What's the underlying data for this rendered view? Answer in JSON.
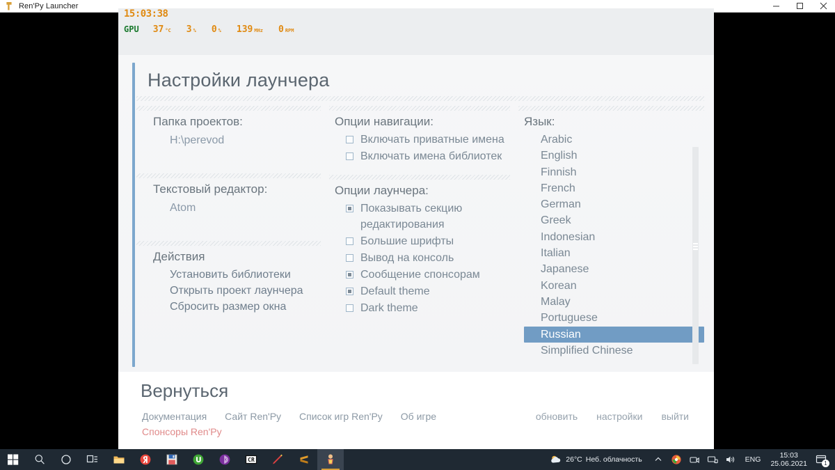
{
  "window": {
    "title": "Ren'Py Launcher",
    "app_icon": "renpy-icon",
    "minimize_label": "—",
    "maximize_label": "⬜",
    "close_label": "✕"
  },
  "hud": {
    "clock": "15:03:38",
    "gpu_label": "GPU",
    "stats": [
      {
        "value": "37",
        "unit": "°C"
      },
      {
        "value": "3",
        "unit": "%"
      },
      {
        "value": "0",
        "unit": "%"
      },
      {
        "value": "139",
        "unit": "MHz"
      },
      {
        "value": "0",
        "unit": "RPM"
      }
    ]
  },
  "page": {
    "title": "Настройки лаунчера"
  },
  "col1": {
    "projects": {
      "label": "Папка проектов:",
      "value": "H:\\perevod"
    },
    "editor": {
      "label": "Текстовый редактор:",
      "value": "Atom"
    },
    "actions": {
      "label": "Действия",
      "items": [
        "Установить библиотеки",
        "Открыть проект лаунчера",
        "Сбросить размер окна"
      ]
    }
  },
  "col2": {
    "navigation": {
      "label": "Опции навигации:",
      "options": [
        {
          "label": "Включать приватные имена",
          "checked": false
        },
        {
          "label": "Включать имена библиотек",
          "checked": false
        }
      ]
    },
    "launcher": {
      "label": "Опции лаунчера:",
      "options": [
        {
          "label": "Показывать секцию редактирования",
          "checked": true
        },
        {
          "label": "Большие шрифты",
          "checked": false
        },
        {
          "label": "Вывод на консоль",
          "checked": false
        },
        {
          "label": "Сообщение спонсорам",
          "checked": true
        },
        {
          "label": "Default theme",
          "checked": true
        },
        {
          "label": "Dark theme",
          "checked": false
        }
      ]
    }
  },
  "col3": {
    "language": {
      "label": "Язык:",
      "selected": "Russian",
      "items": [
        "Arabic",
        "English",
        "Finnish",
        "French",
        "German",
        "Greek",
        "Indonesian",
        "Italian",
        "Japanese",
        "Korean",
        "Malay",
        "Portuguese",
        "Russian",
        "Simplified Chinese"
      ]
    }
  },
  "footer": {
    "back": "Вернуться",
    "links": [
      "Документация",
      "Сайт Ren'Py",
      "Список игр Ren'Py",
      "Об игре"
    ],
    "sponsor": "Спонсоры Ren'Py",
    "right_links": [
      "обновить",
      "настройки",
      "выйти"
    ]
  },
  "taskbar": {
    "items": [
      {
        "name": "start-button",
        "icon": "windows-logo"
      },
      {
        "name": "search-button",
        "icon": "search-icon"
      },
      {
        "name": "cortana-button",
        "icon": "circle-icon"
      },
      {
        "name": "task-view-button",
        "icon": "task-view-icon"
      },
      {
        "name": "file-explorer-button",
        "icon": "folder-icon"
      },
      {
        "name": "yandex-browser-button",
        "icon": "yandex-icon"
      },
      {
        "name": "save-app-button",
        "icon": "floppy-icon"
      },
      {
        "name": "utorrent-button",
        "icon": "utorrent-icon"
      },
      {
        "name": "tor-browser-button",
        "icon": "tor-icon"
      },
      {
        "name": "cr-app-button",
        "icon": "cr-icon"
      },
      {
        "name": "pen-app-button",
        "icon": "pen-icon"
      },
      {
        "name": "sublime-text-button",
        "icon": "sublime-icon"
      },
      {
        "name": "renpy-launcher-button",
        "icon": "renpy-icon"
      }
    ],
    "tray": {
      "weather_temp": "26°C",
      "weather_desc": "Неб. облачность",
      "language": "ENG",
      "time": "15:03",
      "date": "25.06.2021",
      "notification_count": "1"
    }
  },
  "colors": {
    "accent": "#7ca7cd",
    "selection": "#719cc4",
    "sponsor": "#e08a8a",
    "hud_orange": "#e08a12",
    "hud_green": "#1b7a2e",
    "taskbar": "#1f2933"
  }
}
